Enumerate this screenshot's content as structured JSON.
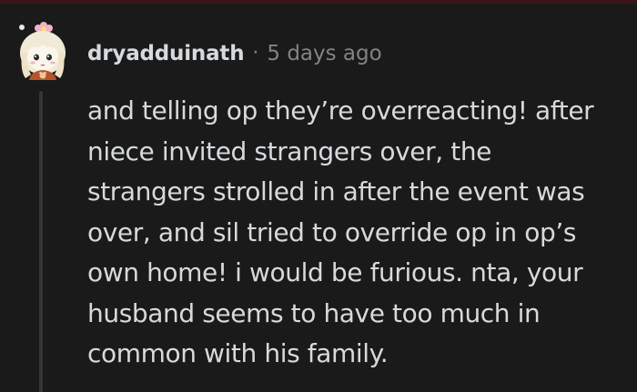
{
  "comment": {
    "author": "dryadduinath",
    "separator": "·",
    "timestamp": "5 days ago",
    "body_lines": [
      "and telling op they’re overreacting! after",
      "niece invited strangers over, the",
      "strangers strolled in after the event was",
      "over, and sil tried to override op in op’s",
      "own home! i would be furious. nta, your",
      "husband seems to have too much in",
      "common with his family."
    ]
  },
  "colors": {
    "background": "#1a1a1b",
    "text": "#d7dadc",
    "muted": "#818384",
    "thread_line": "#343536"
  },
  "icons": {
    "avatar": "anime-girl-avatar-icon"
  }
}
